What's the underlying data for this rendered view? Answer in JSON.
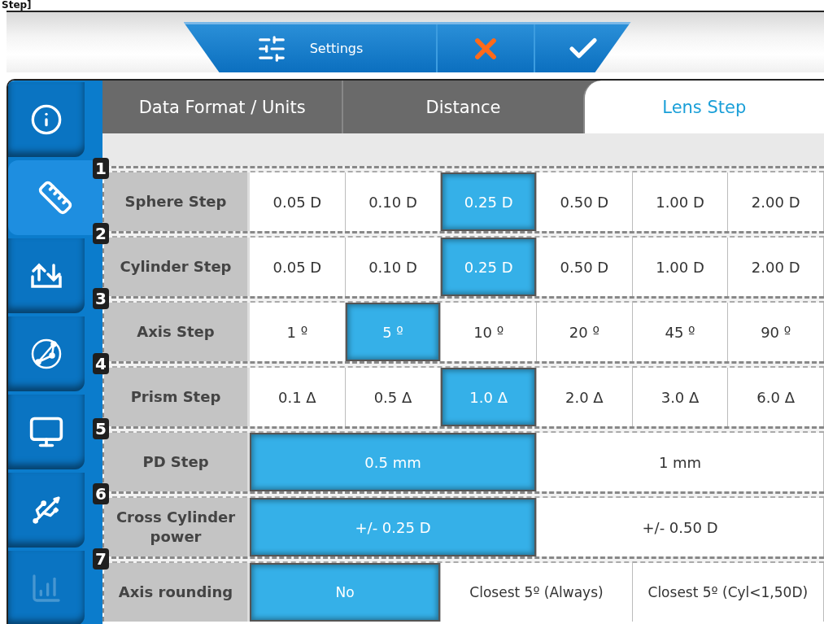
{
  "caption": "Step]",
  "toolbar": {
    "settings_label": "Settings"
  },
  "sidebar": {
    "items": [
      {
        "kind": "info",
        "selected": false,
        "disabled": false
      },
      {
        "kind": "ruler",
        "selected": true,
        "disabled": false
      },
      {
        "kind": "transfer",
        "selected": false,
        "disabled": false
      },
      {
        "kind": "network",
        "selected": false,
        "disabled": false
      },
      {
        "kind": "monitor",
        "selected": false,
        "disabled": false
      },
      {
        "kind": "usb",
        "selected": false,
        "disabled": false
      },
      {
        "kind": "chart",
        "selected": false,
        "disabled": true
      }
    ]
  },
  "tabs": [
    {
      "label": "Data Format / Units",
      "selected": false
    },
    {
      "label": "Distance",
      "selected": false
    },
    {
      "label": "Lens Step",
      "selected": true
    }
  ],
  "rows": [
    {
      "number": "1",
      "label": "Sphere Step",
      "options": [
        {
          "label": "0.05 D",
          "selected": false
        },
        {
          "label": "0.10 D",
          "selected": false
        },
        {
          "label": "0.25 D",
          "selected": true
        },
        {
          "label": "0.50 D",
          "selected": false
        },
        {
          "label": "1.00 D",
          "selected": false
        },
        {
          "label": "2.00 D",
          "selected": false
        }
      ]
    },
    {
      "number": "2",
      "label": "Cylinder Step",
      "options": [
        {
          "label": "0.05 D",
          "selected": false
        },
        {
          "label": "0.10 D",
          "selected": false
        },
        {
          "label": "0.25 D",
          "selected": true
        },
        {
          "label": "0.50 D",
          "selected": false
        },
        {
          "label": "1.00 D",
          "selected": false
        },
        {
          "label": "2.00 D",
          "selected": false
        }
      ]
    },
    {
      "number": "3",
      "label": "Axis Step",
      "options": [
        {
          "label": "1 º",
          "selected": false
        },
        {
          "label": "5 º",
          "selected": true
        },
        {
          "label": "10 º",
          "selected": false
        },
        {
          "label": "20 º",
          "selected": false
        },
        {
          "label": "45 º",
          "selected": false
        },
        {
          "label": "90 º",
          "selected": false
        }
      ]
    },
    {
      "number": "4",
      "label": "Prism Step",
      "options": [
        {
          "label": "0.1 Δ",
          "selected": false
        },
        {
          "label": "0.5 Δ",
          "selected": false
        },
        {
          "label": "1.0 Δ",
          "selected": true
        },
        {
          "label": "2.0 Δ",
          "selected": false
        },
        {
          "label": "3.0 Δ",
          "selected": false
        },
        {
          "label": "6.0 Δ",
          "selected": false
        }
      ]
    },
    {
      "number": "5",
      "label": "PD Step",
      "options": [
        {
          "label": "0.5 mm",
          "selected": true
        },
        {
          "label": "1 mm",
          "selected": false
        }
      ]
    },
    {
      "number": "6",
      "label": "Cross Cylinder power",
      "options": [
        {
          "label": "+/- 0.25 D",
          "selected": true
        },
        {
          "label": "+/- 0.50 D",
          "selected": false
        }
      ]
    },
    {
      "number": "7",
      "label": "Axis rounding",
      "options": [
        {
          "label": "No",
          "selected": true
        },
        {
          "label": "Closest 5º (Always)",
          "selected": false
        },
        {
          "label": "Closest 5º (Cyl<1,50D)",
          "selected": false
        }
      ]
    }
  ]
}
